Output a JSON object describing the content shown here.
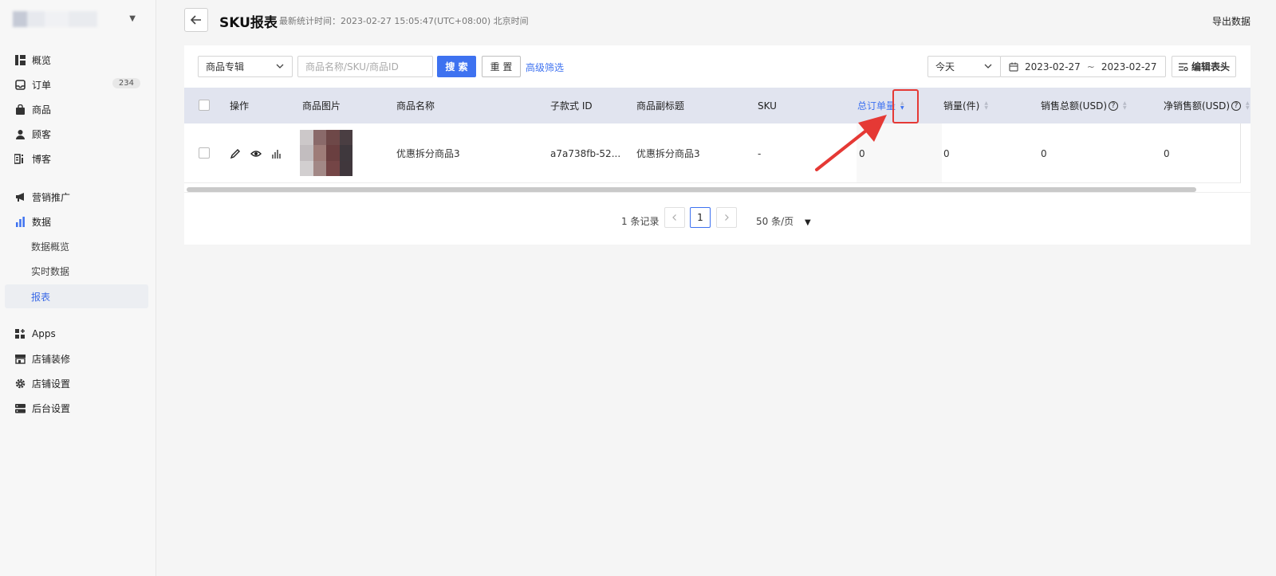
{
  "sidebar": {
    "items": [
      {
        "label": "概览",
        "icon": "overview-icon"
      },
      {
        "label": "订单",
        "icon": "inbox-icon",
        "badge": "234"
      },
      {
        "label": "商品",
        "icon": "bag-icon"
      },
      {
        "label": "顾客",
        "icon": "person-icon"
      },
      {
        "label": "博客",
        "icon": "blog-icon"
      },
      {
        "label": "营销推广",
        "icon": "megaphone-icon"
      },
      {
        "label": "数据",
        "icon": "bar-chart-icon"
      },
      {
        "label": "数据概览",
        "sub": true
      },
      {
        "label": "实时数据",
        "sub": true
      },
      {
        "label": "报表",
        "sub": true,
        "active": true
      },
      {
        "label": "Apps",
        "icon": "apps-icon"
      },
      {
        "label": "店铺装修",
        "icon": "storefront-icon"
      },
      {
        "label": "店铺设置",
        "icon": "gear-icon"
      },
      {
        "label": "后台设置",
        "icon": "server-icon"
      }
    ]
  },
  "header": {
    "title": "SKU报表",
    "stat_time": "最新统计时间：2023-02-27 15:05:47(UTC+08:00) 北京时间",
    "export_label": "导出数据"
  },
  "filters": {
    "category_select": "商品专辑",
    "search_placeholder": "商品名称/SKU/商品ID",
    "search_label": "搜 索",
    "reset_label": "重 置",
    "advanced_label": "高级筛选",
    "period_select": "今天",
    "date_start": "2023-02-27",
    "date_sep": "~",
    "date_end": "2023-02-27",
    "edit_header_label": "编辑表头"
  },
  "table": {
    "columns": {
      "action": "操作",
      "image": "商品图片",
      "name": "商品名称",
      "variant_id": "子款式 ID",
      "subtitle": "商品副标题",
      "sku": "SKU",
      "total_orders": "总订单量",
      "sales_qty": "销量(件)",
      "total_sales": "销售总额(USD)",
      "net_sales": "净销售额(USD)"
    },
    "rows": [
      {
        "name": "优惠拆分商品3",
        "variant_id": "a7a738fb-52...",
        "subtitle": "优惠拆分商品3",
        "sku": "-",
        "total_orders": "0",
        "sales_qty": "0",
        "total_sales": "0",
        "net_sales": "0"
      }
    ]
  },
  "pagination": {
    "total": "1 条记录",
    "current_page": "1",
    "page_size": "50 条/页"
  },
  "colors": {
    "accent": "#3e72f0",
    "annotation": "#e53935"
  }
}
